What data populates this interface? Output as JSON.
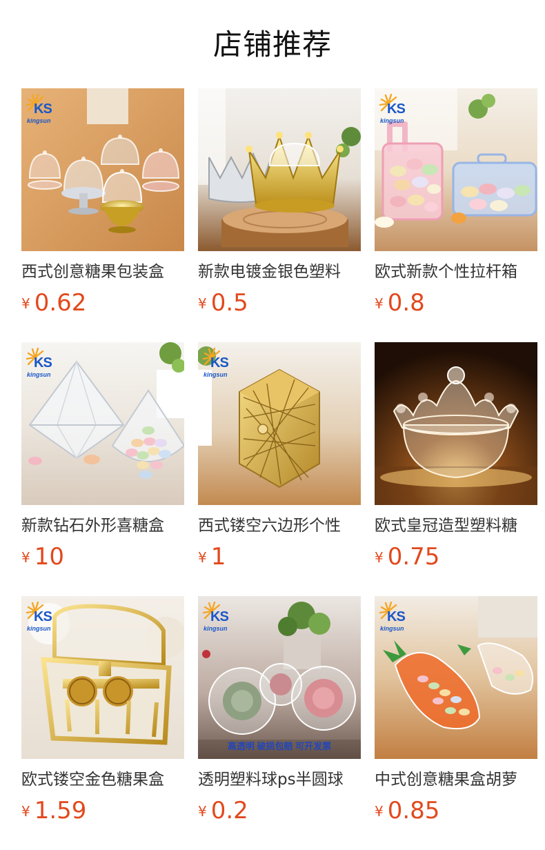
{
  "page_title": "店铺推荐",
  "colors": {
    "price": "#e2491d",
    "title_text": "#111111",
    "name_text": "#333333",
    "brand_blue": "#1a57c7"
  },
  "logo": {
    "mark": "KS",
    "brand": "kingsun"
  },
  "products": [
    {
      "name": "西式创意糖果包装盒",
      "currency": "¥",
      "price": "0.62",
      "image": "clear-dome-candy-boxes"
    },
    {
      "name": "新款电镀金银色塑料",
      "currency": "¥",
      "price": "0.5",
      "image": "gold-silver-crown-boxes"
    },
    {
      "name": "欧式新款个性拉杆箱",
      "currency": "¥",
      "price": "0.8",
      "image": "trolley-suitcase-candy-boxes"
    },
    {
      "name": "新款钻石外形喜糖盒",
      "currency": "¥",
      "price": "10",
      "image": "diamond-shaped-candy-boxes"
    },
    {
      "name": "西式镂空六边形个性",
      "currency": "¥",
      "price": "1",
      "image": "gold-hexagon-hollow-box"
    },
    {
      "name": "欧式皇冠造型塑料糖",
      "currency": "¥",
      "price": "0.75",
      "image": "clear-crown-candy-box"
    },
    {
      "name": "欧式镂空金色糖果盒",
      "currency": "¥",
      "price": "1.59",
      "image": "gold-treasure-chest-box"
    },
    {
      "name": "透明塑料球ps半圆球",
      "currency": "¥",
      "price": "0.2",
      "image": "clear-plastic-balls-with-roses",
      "image_caption": "高透明 破损包赔 可开发票"
    },
    {
      "name": "中式创意糖果盒胡萝",
      "currency": "¥",
      "price": "0.85",
      "image": "carrot-shaped-candy-boxes"
    }
  ]
}
